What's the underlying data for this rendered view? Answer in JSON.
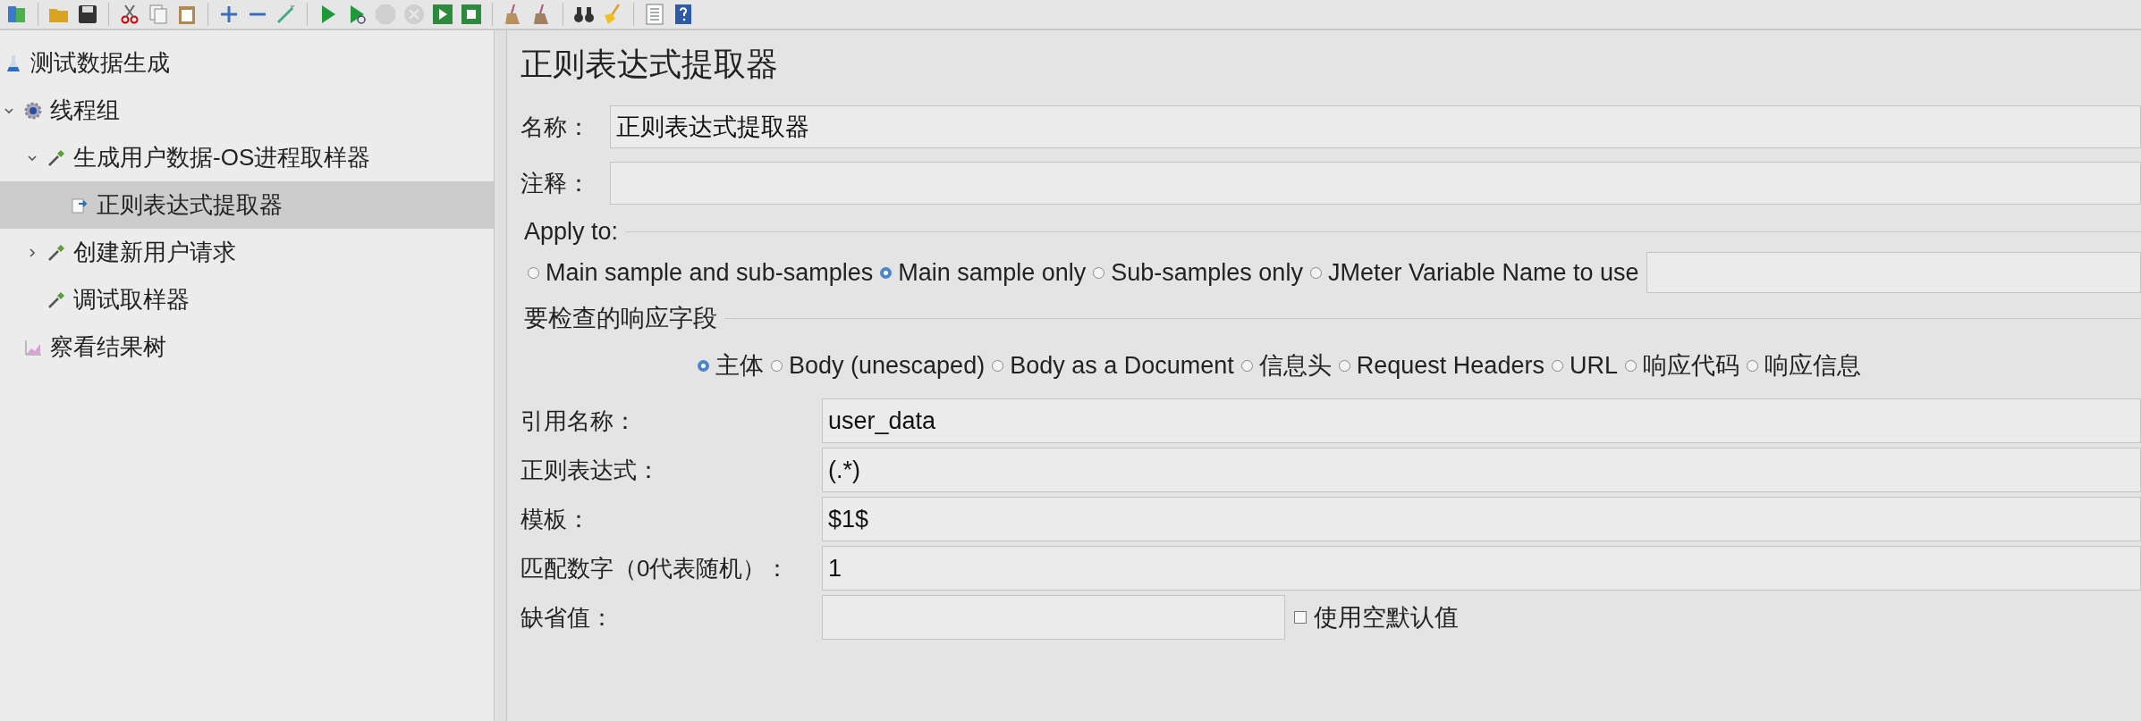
{
  "tree": [
    {
      "label": "测试数据生成",
      "kind": "test-plan",
      "selected": false,
      "children": [
        {
          "label": "线程组",
          "kind": "thread-group",
          "selected": false,
          "expanded": true,
          "children": [
            {
              "label": "生成用户数据-OS进程取样器",
              "kind": "sampler",
              "selected": false,
              "expanded": true,
              "children": [
                {
                  "label": "正则表达式提取器",
                  "kind": "extractor",
                  "selected": true
                }
              ]
            },
            {
              "label": "创建新用户请求",
              "kind": "sampler",
              "selected": false,
              "expanded": false
            },
            {
              "label": "调试取样器",
              "kind": "sampler",
              "selected": false
            }
          ]
        },
        {
          "label": "察看结果树",
          "kind": "listener",
          "selected": false
        }
      ]
    }
  ],
  "panel": {
    "title": "正则表达式提取器",
    "name": {
      "label": "名称：",
      "value": "正则表达式提取器"
    },
    "comment": {
      "label": "注释："
    },
    "apply_to": {
      "title": "Apply to:",
      "options": [
        {
          "label": "Main sample and sub-samples",
          "selected": false
        },
        {
          "label": "Main sample only",
          "selected": true
        },
        {
          "label": "Sub-samples only",
          "selected": false
        },
        {
          "label": "JMeter Variable Name to use",
          "selected": false
        }
      ]
    },
    "response_field": {
      "title": "要检查的响应字段",
      "options": [
        {
          "label": "主体",
          "selected": true
        },
        {
          "label": "Body (unescaped)",
          "selected": false
        },
        {
          "label": "Body as a Document",
          "selected": false
        },
        {
          "label": "信息头",
          "selected": false
        },
        {
          "label": "Request Headers",
          "selected": false
        },
        {
          "label": "URL",
          "selected": false
        },
        {
          "label": "响应代码",
          "selected": false
        },
        {
          "label": "响应信息",
          "selected": false
        }
      ]
    },
    "fields": [
      {
        "label": "引用名称：",
        "value": "user_data"
      },
      {
        "label": "正则表达式：",
        "value": "(.*)"
      },
      {
        "label": "模板：",
        "value": "$1$"
      },
      {
        "label": "匹配数字（0代表随机）：",
        "value": "1"
      },
      {
        "label": "缺省值：",
        "checkbox": {
          "label": "使用空默认值",
          "checked": false
        }
      }
    ]
  }
}
